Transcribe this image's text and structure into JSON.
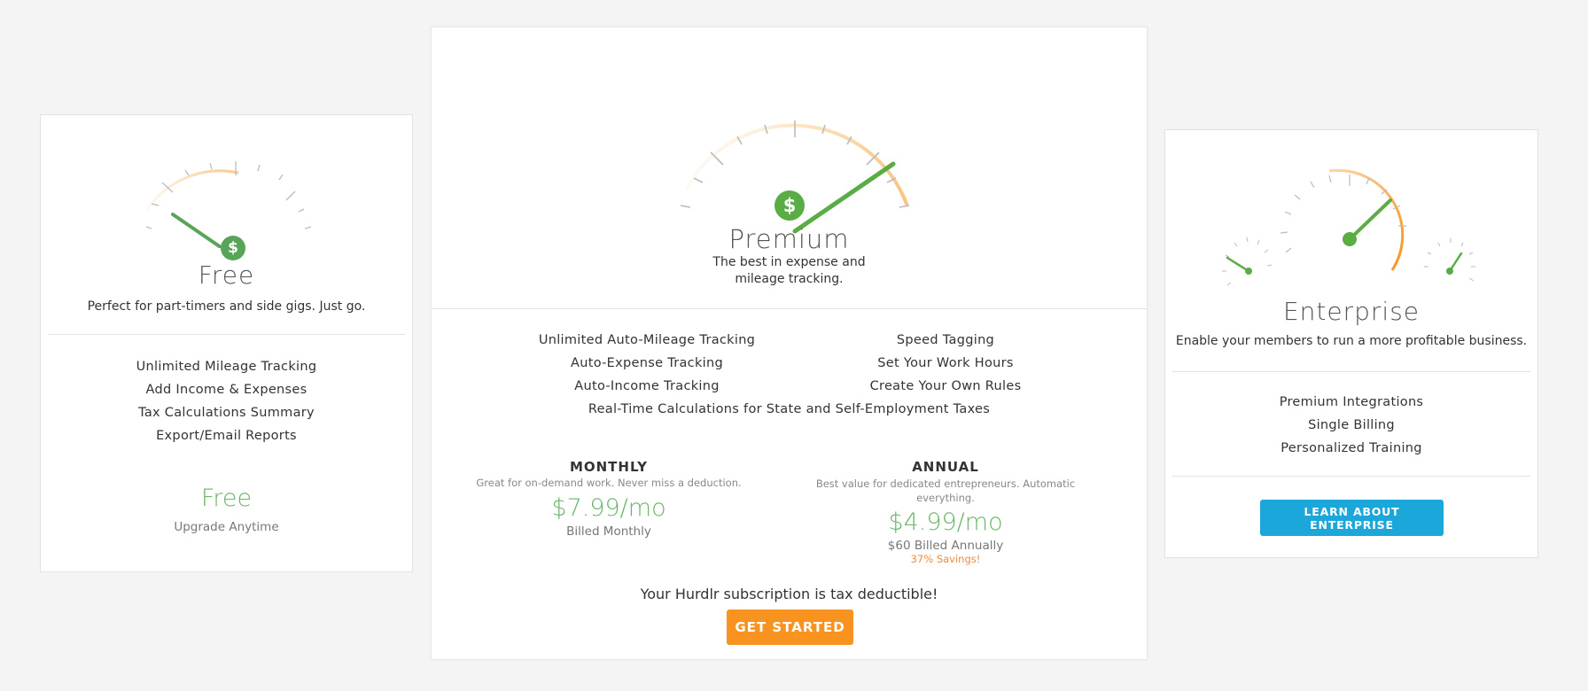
{
  "free": {
    "title": "Free",
    "subtitle": "Perfect for part-timers and side gigs. Just go.",
    "features": [
      "Unlimited Mileage Tracking",
      "Add Income & Expenses",
      "Tax Calculations Summary",
      "Export/Email Reports"
    ],
    "price": "Free",
    "price_note": "Upgrade Anytime"
  },
  "premium": {
    "title": "Premium",
    "subtitle_line1": "The best in expense and",
    "subtitle_line2": "mileage tracking.",
    "features_left": [
      "Unlimited Auto-Mileage Tracking",
      "Auto-Expense Tracking",
      "Auto-Income Tracking"
    ],
    "features_right": [
      "Speed Tagging",
      "Set Your Work Hours",
      "Create Your Own Rules"
    ],
    "feature_wide": "Real-Time Calculations for State and Self-Employment Taxes",
    "monthly": {
      "heading": "MONTHLY",
      "desc": "Great for on-demand work. Never miss a deduction.",
      "price": "$7.99/mo",
      "billing": "Billed Monthly"
    },
    "annual": {
      "heading": "ANNUAL",
      "desc_line1": "Best value for dedicated entrepreneurs. Automatic",
      "desc_line2": "everything.",
      "price": "$4.99/mo",
      "billing": "$60 Billed Annually",
      "savings": "37% Savings!"
    },
    "tax_note": "Your Hurdlr subscription is tax deductible!",
    "cta_label": "GET STARTED"
  },
  "enterprise": {
    "title": "Enterprise",
    "subtitle": "Enable your members to run a more profitable business.",
    "features": [
      "Premium Integrations",
      "Single Billing",
      "Personalized Training"
    ],
    "cta_label": "LEARN ABOUT ENTERPRISE"
  },
  "gauge_icon_symbol": "$",
  "colors": {
    "green": "#6ab56a",
    "gauge_green": "#5aac44",
    "orange": "#f7931e",
    "blue": "#1ba7d9",
    "savings_orange": "#f08a3c"
  }
}
